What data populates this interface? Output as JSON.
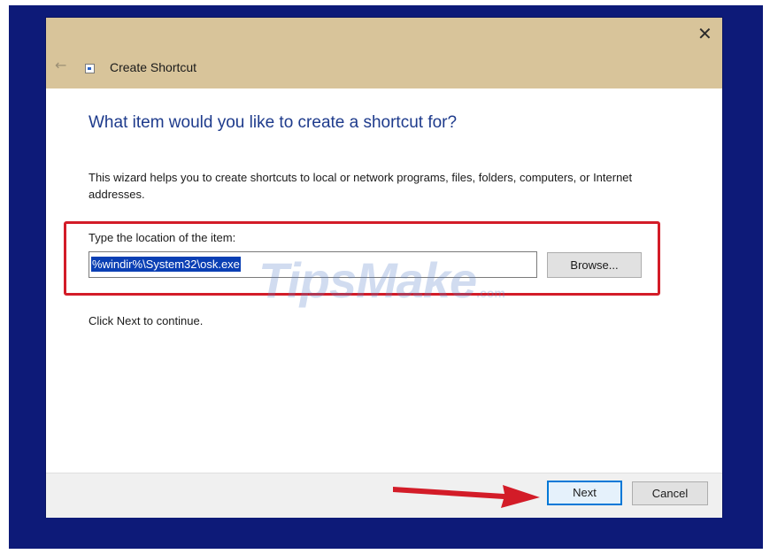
{
  "dialog": {
    "title": "Create Shortcut",
    "back_icon": "back-arrow-icon",
    "close_glyph": "✕",
    "heading": "What item would you like to create a shortcut for?",
    "description": "This wizard helps you to create shortcuts to local or network programs, files, folders, computers, or Internet addresses.",
    "location_label": "Type the location of the item:",
    "location_value": "%windir%\\System32\\osk.exe",
    "browse_label": "Browse...",
    "hint": "Click Next to continue.",
    "next_label": "Next",
    "cancel_label": "Cancel"
  },
  "annotations": {
    "highlight_color": "#d31c28",
    "arrow_color": "#d31c28"
  },
  "watermark": {
    "text": "TipsMake",
    "suffix": ".com"
  },
  "colors": {
    "desktop": "#0d1a78",
    "titlebar": "#d8c49a",
    "heading": "#1e3b8c",
    "selection": "#0a3fb4",
    "focus_border": "#0078d7"
  }
}
